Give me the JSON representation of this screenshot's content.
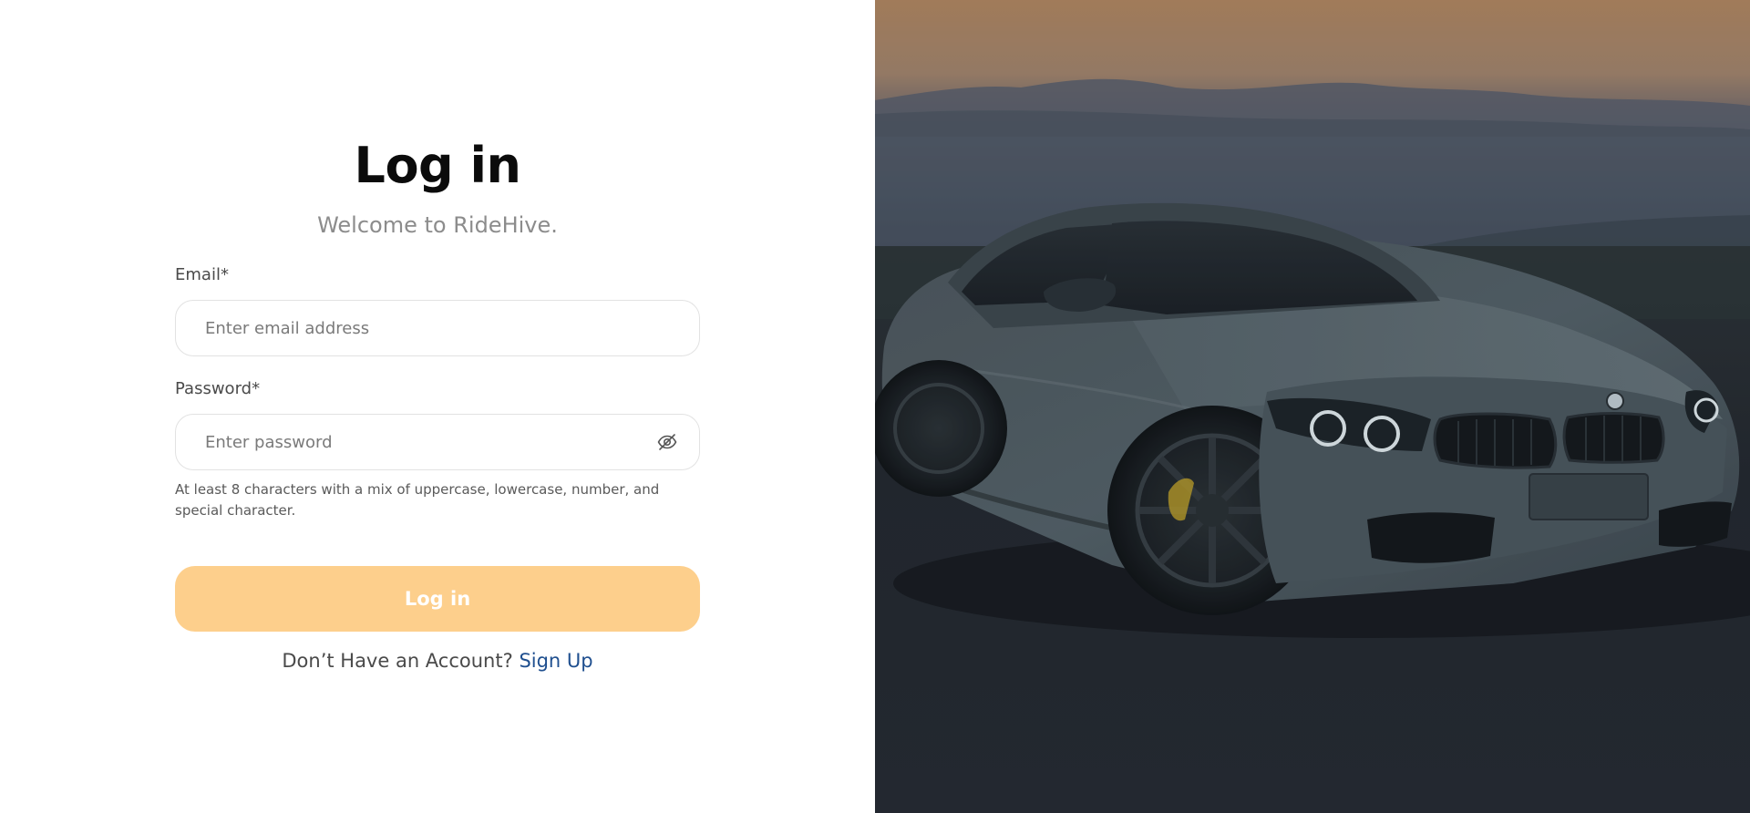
{
  "login": {
    "title": "Log in",
    "subtitle": "Welcome to RideHive.",
    "email_label": "Email*",
    "email_placeholder": "Enter email address",
    "email_value": "",
    "password_label": "Password*",
    "password_placeholder": "Enter password",
    "password_value": "",
    "password_hint": "At least 8 characters with a mix of uppercase, lowercase, number, and special character.",
    "button_label": "Log in",
    "no_account_text": "Don’t Have an Account?",
    "signup_link": "Sign Up"
  },
  "icons": {
    "password_toggle": "eye-off-icon"
  },
  "colors": {
    "button_bg": "#fdcf8c",
    "link": "#1f4f8f",
    "title": "#0b0b0b",
    "subtitle": "#8c8c8c"
  }
}
